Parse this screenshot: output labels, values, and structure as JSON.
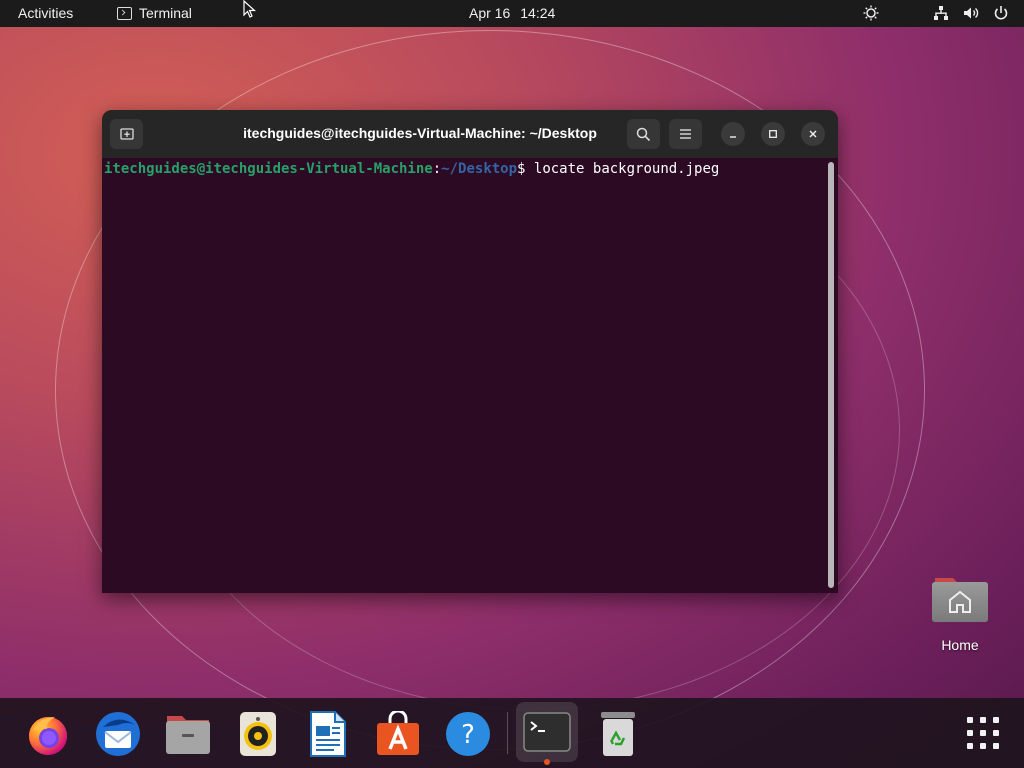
{
  "topbar": {
    "activities": "Activities",
    "app_name": "Terminal",
    "date": "Apr 16",
    "time": "14:24",
    "tray_icons": [
      "brightness-icon",
      "network-icon",
      "volume-icon",
      "power-icon"
    ]
  },
  "terminal": {
    "title": "itechguides@itechguides-Virtual-Machine: ~/Desktop",
    "prompt_user": "itechguides@itechguides-Virtual-Machine",
    "prompt_sep": ":",
    "prompt_path": "~/Desktop",
    "prompt_symbol": "$ ",
    "command": "locate background.jpeg",
    "buttons": [
      "new-tab-icon",
      "search-icon",
      "menu-icon",
      "minimize-icon",
      "maximize-icon",
      "close-icon"
    ]
  },
  "desktop": {
    "home_label": "Home"
  },
  "dock": {
    "apps": [
      "Firefox",
      "Thunderbird",
      "Files",
      "Rhythmbox",
      "LibreOffice Writer",
      "Ubuntu Software",
      "Help",
      "Terminal",
      "Trash"
    ],
    "active_app": "Terminal",
    "accent": "#e95420"
  },
  "colors": {
    "terminal_bg": "#2c0a24",
    "prompt_user": "#26a269",
    "prompt_path": "#3465a4",
    "ubuntu_orange": "#e95420"
  }
}
